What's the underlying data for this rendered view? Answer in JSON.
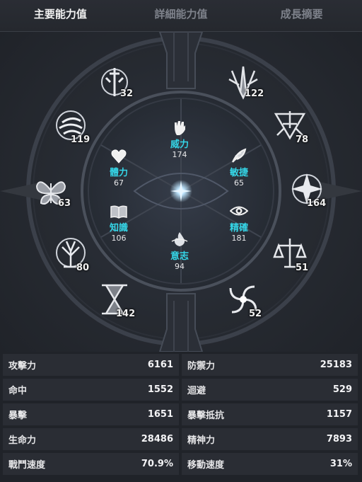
{
  "tabs": [
    {
      "label": "主要能力值",
      "active": true
    },
    {
      "label": "詳細能力值",
      "active": false
    },
    {
      "label": "成長摘要",
      "active": false
    }
  ],
  "inner_stats": {
    "power": {
      "label": "威力",
      "value": "174",
      "icon": "fist-icon"
    },
    "health": {
      "label": "體力",
      "value": "67",
      "icon": "heart-icon"
    },
    "agility": {
      "label": "敏捷",
      "value": "65",
      "icon": "feather-icon"
    },
    "knowledge": {
      "label": "知識",
      "value": "106",
      "icon": "book-icon"
    },
    "precision": {
      "label": "精確",
      "value": "181",
      "icon": "eye-icon"
    },
    "will": {
      "label": "意志",
      "value": "94",
      "icon": "flame-icon"
    }
  },
  "outer_symbols": [
    {
      "id": "sword",
      "value": "32"
    },
    {
      "id": "blades",
      "value": "122"
    },
    {
      "id": "wind",
      "value": "119"
    },
    {
      "id": "thorns",
      "value": "78"
    },
    {
      "id": "butterfly",
      "value": "63"
    },
    {
      "id": "star",
      "value": "164"
    },
    {
      "id": "tree",
      "value": "80"
    },
    {
      "id": "scales",
      "value": "51"
    },
    {
      "id": "hourglass",
      "value": "142"
    },
    {
      "id": "vortex",
      "value": "52"
    }
  ],
  "stats_table": [
    {
      "label": "攻擊力",
      "value": "6161"
    },
    {
      "label": "防禦力",
      "value": "25183"
    },
    {
      "label": "命中",
      "value": "1552"
    },
    {
      "label": "迴避",
      "value": "529"
    },
    {
      "label": "暴擊",
      "value": "1651"
    },
    {
      "label": "暴擊抵抗",
      "value": "1157"
    },
    {
      "label": "生命力",
      "value": "28486"
    },
    {
      "label": "精神力",
      "value": "7893"
    },
    {
      "label": "戰鬥速度",
      "value": "70.9%"
    },
    {
      "label": "移動速度",
      "value": "31%"
    }
  ],
  "colors": {
    "accent": "#35d6e8",
    "panel": "#2a2d34",
    "background": "#23262d"
  }
}
